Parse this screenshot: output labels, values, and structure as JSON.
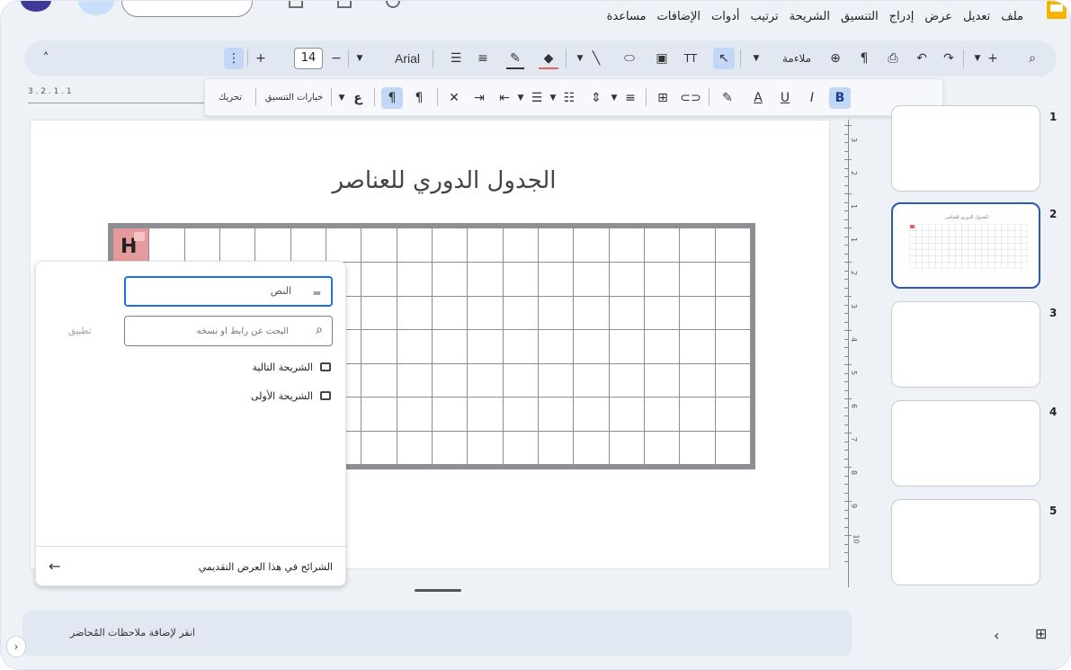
{
  "menu": [
    "ملف",
    "تعديل",
    "عرض",
    "إدراج",
    "التنسيق",
    "الشريحة",
    "ترتيب",
    "أدوات",
    "الإضافات",
    "مساعدة"
  ],
  "toolbar": {
    "font_size": "14",
    "font_name": "Arial",
    "fit_label": "ملاءمة",
    "collapse_icon": "chevron-up-icon"
  },
  "format_toolbar": {
    "move_label": "تحريك",
    "format_options_label": "خيارات التنسيق",
    "bold": "B",
    "italic": "I",
    "underline": "U",
    "text_color": "A",
    "arabic_char": "ع"
  },
  "slide": {
    "title": "الجدول الدوري للعناصر",
    "cell_symbol": "H",
    "accent_color": "#e59b9b"
  },
  "link_panel": {
    "text_value": "النص",
    "search_placeholder": "البحث عن رابط أو نسخه",
    "apply_label": "تطبيق",
    "options": [
      "الشريحة التالية",
      "الشريحة الأولى"
    ],
    "footer_label": "الشرائح في هذا العرض التقديمي"
  },
  "slides_panel": {
    "numbers": [
      "1",
      "2",
      "3",
      "4",
      "5"
    ],
    "active_index": 2,
    "mini_title": "الجدول الدوري للعناصر"
  },
  "ruler": {
    "vertical_labels": [
      "3",
      "2",
      "1",
      "1",
      "2",
      "3",
      "4",
      "5",
      "6",
      "7",
      "8",
      "9",
      "10"
    ],
    "top_labels": "3 . 2 . 1 . 1"
  },
  "notes": {
    "placeholder": "انقر لإضافة ملاحظات المُحاضر"
  }
}
